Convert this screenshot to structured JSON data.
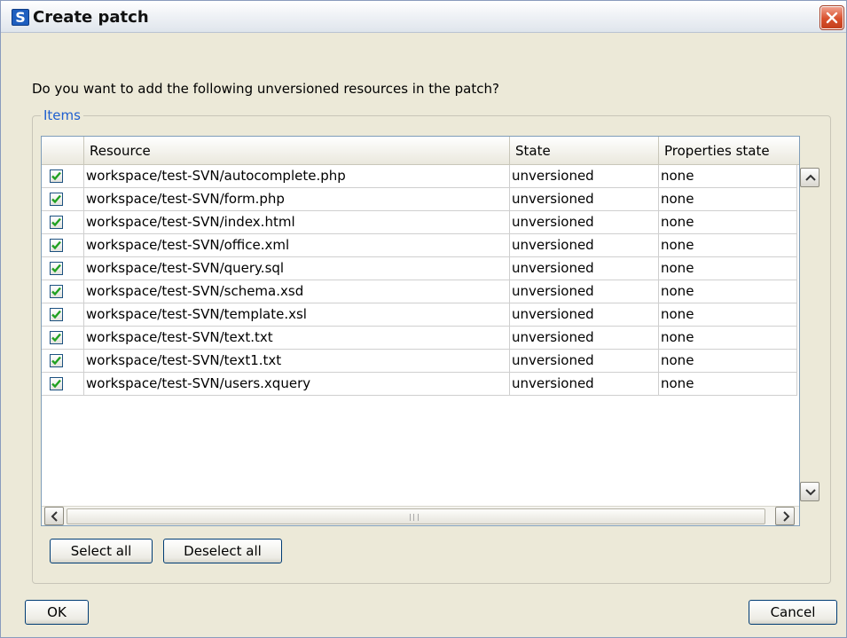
{
  "window": {
    "title": "Create patch",
    "app_icon_letter": "S"
  },
  "prompt": "Do you want to add the following unversioned resources in the patch?",
  "group": {
    "label": "Items"
  },
  "table": {
    "columns": [
      "",
      "Resource",
      "State",
      "Properties state"
    ],
    "rows": [
      {
        "checked": true,
        "resource": "workspace/test-SVN/autocomplete.php",
        "state": "unversioned",
        "props": "none"
      },
      {
        "checked": true,
        "resource": "workspace/test-SVN/form.php",
        "state": "unversioned",
        "props": "none"
      },
      {
        "checked": true,
        "resource": "workspace/test-SVN/index.html",
        "state": "unversioned",
        "props": "none"
      },
      {
        "checked": true,
        "resource": "workspace/test-SVN/office.xml",
        "state": "unversioned",
        "props": "none"
      },
      {
        "checked": true,
        "resource": "workspace/test-SVN/query.sql",
        "state": "unversioned",
        "props": "none"
      },
      {
        "checked": true,
        "resource": "workspace/test-SVN/schema.xsd",
        "state": "unversioned",
        "props": "none"
      },
      {
        "checked": true,
        "resource": "workspace/test-SVN/template.xsl",
        "state": "unversioned",
        "props": "none"
      },
      {
        "checked": true,
        "resource": "workspace/test-SVN/text.txt",
        "state": "unversioned",
        "props": "none"
      },
      {
        "checked": true,
        "resource": "workspace/test-SVN/text1.txt",
        "state": "unversioned",
        "props": "none"
      },
      {
        "checked": true,
        "resource": "workspace/test-SVN/users.xquery",
        "state": "unversioned",
        "props": "none"
      }
    ]
  },
  "buttons": {
    "select_all": "Select all",
    "deselect_all": "Deselect all",
    "ok": "OK",
    "cancel": "Cancel"
  },
  "icons": {
    "app": "s-logo-icon",
    "close": "close-icon",
    "check": "checkmark-icon",
    "up": "chevron-up-icon",
    "down": "chevron-down-icon",
    "left": "chevron-left-icon",
    "right": "chevron-right-icon"
  },
  "colors": {
    "accent": "#1f5fd0",
    "check": "#21a121",
    "close": "#d8502c"
  }
}
